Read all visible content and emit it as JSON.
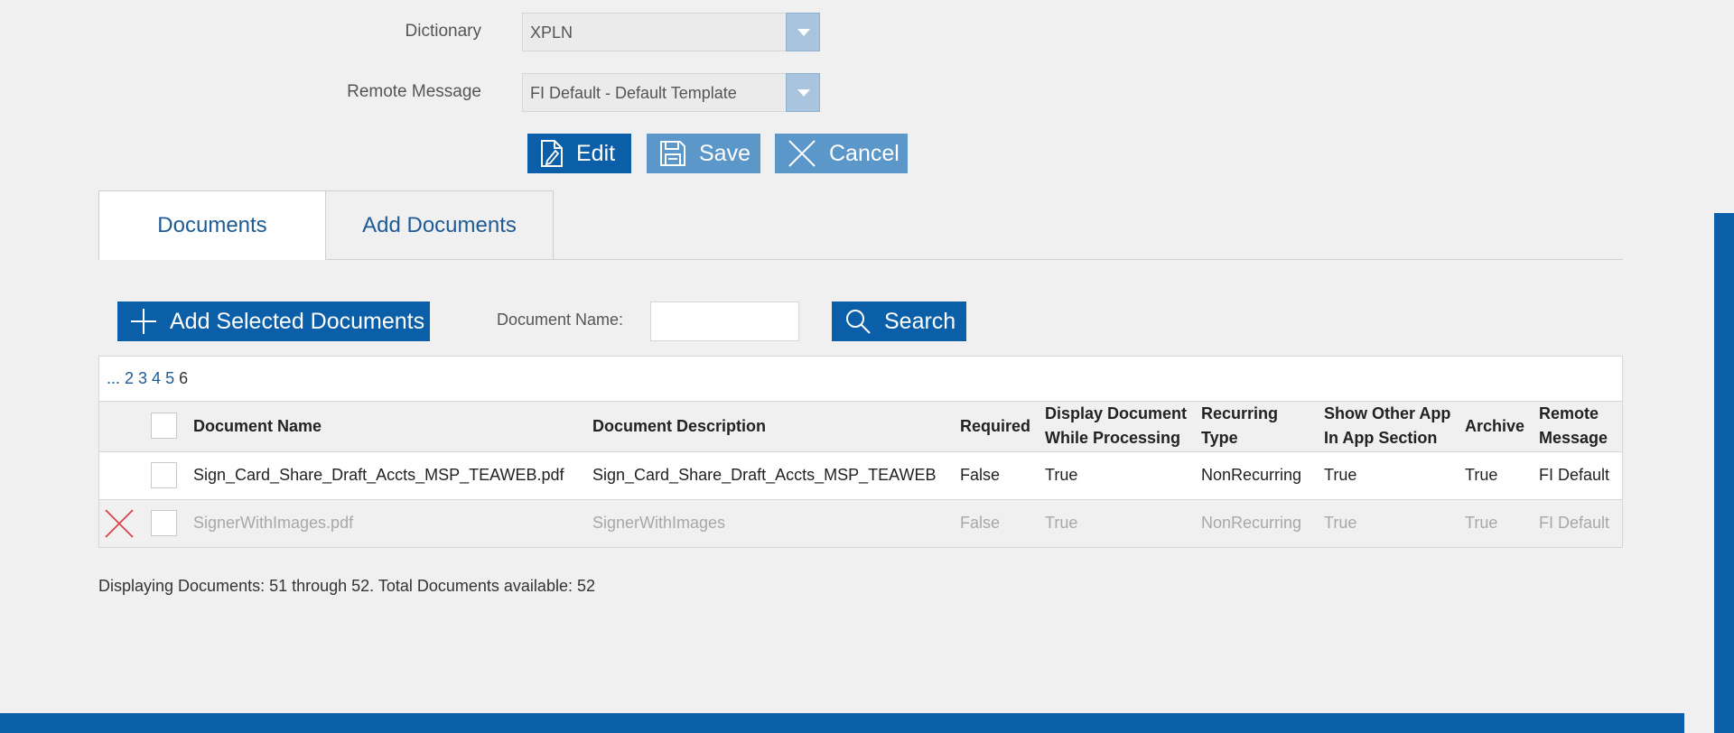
{
  "form": {
    "dictionary_label": "Dictionary",
    "dictionary_value": "XPLN",
    "remote_message_label": "Remote Message",
    "remote_message_value": "FI Default - Default Template"
  },
  "actions": {
    "edit": "Edit",
    "save": "Save",
    "cancel": "Cancel"
  },
  "tabs": [
    {
      "label": "Documents"
    },
    {
      "label": "Add Documents"
    }
  ],
  "toolbar": {
    "add_selected": "Add Selected Documents",
    "doc_name_label": "Document Name:",
    "doc_name_value": "",
    "search": "Search"
  },
  "pager": {
    "ellipsis": "...",
    "pages": [
      "2",
      "3",
      "4",
      "5"
    ],
    "current": "6"
  },
  "table": {
    "headers": {
      "name": "Document Name",
      "description": "Document Description",
      "required": "Required",
      "display_1": "Display Document",
      "display_2": "While Processing",
      "recurring_1": "Recurring",
      "recurring_2": "Type",
      "show_1": "Show Other App",
      "show_2": "In App Section",
      "archive": "Archive",
      "remote_1": "Remote",
      "remote_2": "Message"
    },
    "rows": [
      {
        "name": "Sign_Card_Share_Draft_Accts_MSP_TEAWEB.pdf",
        "description": "Sign_Card_Share_Draft_Accts_MSP_TEAWEB",
        "required": "False",
        "display": "True",
        "recurring": "NonRecurring",
        "show": "True",
        "archive": "True",
        "remote": "FI Default"
      },
      {
        "name": "SignerWithImages.pdf",
        "description": "SignerWithImages",
        "required": "False",
        "display": "True",
        "recurring": "NonRecurring",
        "show": "True",
        "archive": "True",
        "remote": "FI Default"
      }
    ]
  },
  "footer": {
    "status": "Displaying Documents: 51 through 52. Total Documents available: 52"
  },
  "colors": {
    "primary": "#0b5ea8",
    "disabled_button": "#5c97c9",
    "delete_icon": "#d9434b",
    "link": "#1e5b95"
  },
  "icons": {
    "edit": "document-edit-icon",
    "save": "floppy-disk-icon",
    "cancel": "x-close-icon",
    "add": "plus-icon",
    "search": "magnifier-icon",
    "delete": "red-x-delete-icon",
    "dropdown": "chevron-down-icon"
  }
}
